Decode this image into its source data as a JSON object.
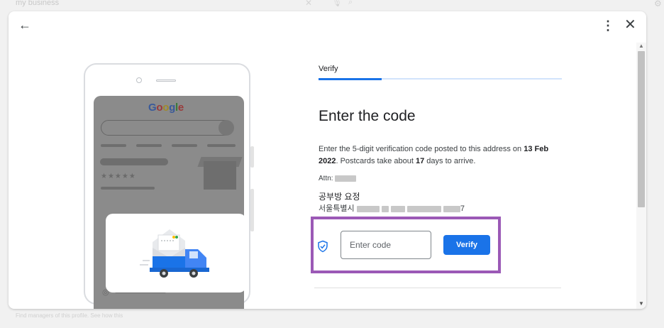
{
  "background": {
    "search_query": "my business",
    "footer_text": "Find managers of this profile. See how this"
  },
  "icons": {
    "back": "arrow-left-icon",
    "more": "more-vert-icon",
    "close": "close-icon",
    "shield": "shield-check-icon",
    "search_clear": "close-icon",
    "mic": "mic-icon",
    "search": "search-icon",
    "settings": "gear-icon"
  },
  "colors": {
    "accent": "#1a73e8",
    "highlight": "#9b59b6",
    "progress_track": "#d2e3fc"
  },
  "illustration": {
    "logo": "Google",
    "stars": "★★★★★"
  },
  "form": {
    "step_label": "Verify",
    "progress_fraction": 0.26,
    "heading": "Enter the code",
    "description_prefix": "Enter the 5-digit verification code posted to this address on ",
    "date": "13 Feb 2022",
    "description_mid": ". Postcards take about ",
    "days": "17",
    "description_suffix": " days to arrive.",
    "attn_label": "Attn:",
    "business_name": "공부방 요정",
    "address_prefix": "서울특별시",
    "address_suffix": "7",
    "code_placeholder": "Enter code",
    "code_value": "",
    "verify_button": "Verify"
  }
}
